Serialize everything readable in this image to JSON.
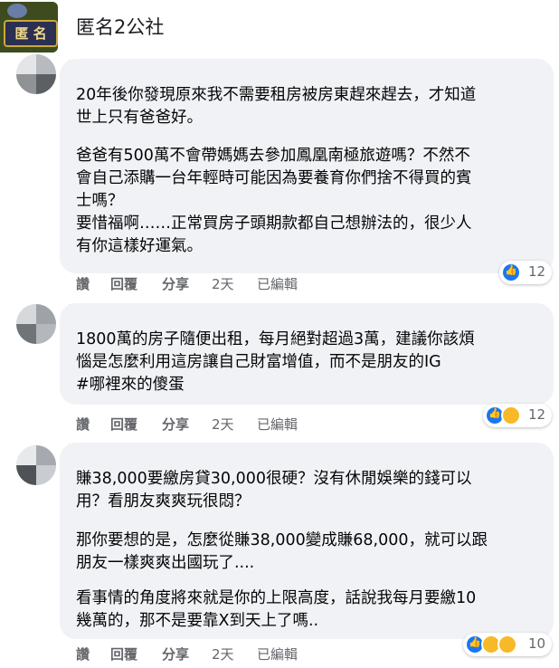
{
  "header": {
    "title": "匿名2公社",
    "logo_text": "匿 名"
  },
  "comments": [
    {
      "paragraphs": [
        "20年後你發現原來我不需要租房被房東趕來趕去，才知道\n世上只有爸爸好。",
        "爸爸有500萬不會帶媽媽去參加鳳凰南極旅遊嗎？不然不\n會自己添購一台年輕時可能因為要養育你們捨不得買的賓\n士嗎？\n要惜福啊……正常買房子頭期款都自己想辦法的，很少人\n有你這樣好運氣。"
      ],
      "actions": {
        "like": "讚",
        "reply": "回覆",
        "share": "分享",
        "time": "2天",
        "edited": "已編輯"
      },
      "reaction_count": "12"
    },
    {
      "paragraphs": [
        "1800萬的房子隨便出租，每月絕對超過3萬，建議你該煩\n惱是怎麼利用這房讓自己財富增值，而不是朋友的IG\n#哪裡來的傻蛋"
      ],
      "actions": {
        "like": "讚",
        "reply": "回覆",
        "share": "分享",
        "time": "2天",
        "edited": "已編輯"
      },
      "reaction_count": "12"
    },
    {
      "paragraphs": [
        "賺38,000要繳房貸30,000很硬？沒有休閒娛樂的錢可以\n用？看朋友爽爽玩很悶？",
        "那你要想的是，怎麼從賺38,000變成賺68,000，就可以跟\n朋友一樣爽爽出國玩了....",
        "看事情的角度將來就是你的上限高度，話說我每月要繳10\n幾萬的，那不是要靠X到天上了嗎.."
      ],
      "actions": {
        "like": "讚",
        "reply": "回覆",
        "share": "分享",
        "time": "2天",
        "edited": "已編輯"
      },
      "reaction_count": "10"
    }
  ],
  "colors": {
    "bubble": "#f0f2f5",
    "meta": "#65676b",
    "like_blue": "#1877f2",
    "haha_yellow": "#f7b928"
  },
  "icons": [
    "like-icon",
    "haha-icon",
    "wow-icon"
  ]
}
